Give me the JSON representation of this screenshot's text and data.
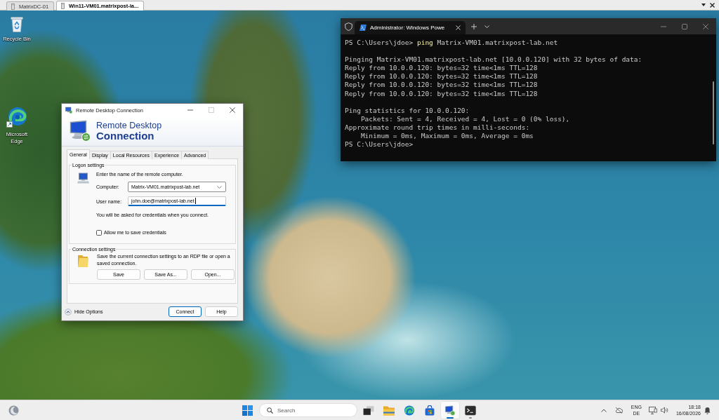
{
  "session_tabs": [
    {
      "label": "MatrixDC-01",
      "selected": false
    },
    {
      "label": "Win11-VM01.matrixpost-la...",
      "selected": true
    }
  ],
  "desktop_icons": [
    {
      "kind": "recycle-bin",
      "label": "Recycle Bin"
    },
    {
      "kind": "browser",
      "label": "Microsoft Edge"
    }
  ],
  "rdp_dialog": {
    "title": "Remote Desktop Connection",
    "maximize_disabled": true,
    "banner": {
      "line_1": "Remote Desktop",
      "line_2": "Connection"
    },
    "tabs": [
      {
        "label": "General",
        "selected": true
      },
      {
        "label": "Display",
        "selected": false
      },
      {
        "label": "Local Resources",
        "selected": false
      },
      {
        "label": "Experience",
        "selected": false
      },
      {
        "label": "Advanced",
        "selected": false
      }
    ],
    "logon_settings": {
      "legend": "Logon settings",
      "prompt": "Enter the name of the remote computer.",
      "computer": {
        "label": "Computer:",
        "value": "Matrix-VM01.matrixpost-lab.net"
      },
      "user_name": {
        "label": "User name:",
        "value": "john.doe@matrixpost-lab.net",
        "focused": true
      },
      "note": "You will be asked for credentials when you connect.",
      "save_credentials": {
        "label": "Allow me to save credentials",
        "checked": false
      }
    },
    "connection_settings": {
      "legend": "Connection settings",
      "description": "Save the current connection settings to an RDP file or open a saved connection.",
      "buttons": [
        "Save",
        "Save As...",
        "Open..."
      ]
    },
    "options_toggle": {
      "label": "Hide Options",
      "expanded": true
    },
    "buttons": [
      {
        "label": "Connect",
        "default": true
      },
      {
        "label": "Help",
        "default": false
      }
    ]
  },
  "terminal": {
    "tab_title": "Administrator: Windows Powe",
    "lines": [
      {
        "kind": "command",
        "prompt": "PS C:\\Users\\jdoe>",
        "command": "ping",
        "args": "Matrix-VM01.matrixpost-lab.net"
      },
      {
        "kind": "blank"
      },
      {
        "kind": "output",
        "text": "Pinging Matrix-VM01.matrixpost-lab.net [10.0.0.120] with 32 bytes of data:"
      },
      {
        "kind": "output",
        "text": "Reply from 10.0.0.120: bytes=32 time<1ms TTL=128"
      },
      {
        "kind": "output",
        "text": "Reply from 10.0.0.120: bytes=32 time<1ms TTL=128"
      },
      {
        "kind": "output",
        "text": "Reply from 10.0.0.120: bytes=32 time<1ms TTL=128"
      },
      {
        "kind": "output",
        "text": "Reply from 10.0.0.120: bytes=32 time<1ms TTL=128"
      },
      {
        "kind": "blank"
      },
      {
        "kind": "output",
        "text": "Ping statistics for 10.0.0.120:"
      },
      {
        "kind": "output",
        "text": "    Packets: Sent = 4, Received = 4, Lost = 0 (0% loss),"
      },
      {
        "kind": "output",
        "text": "Approximate round trip times in milli-seconds:"
      },
      {
        "kind": "output",
        "text": "    Minimum = 0ms, Maximum = 0ms, Average = 0ms"
      },
      {
        "kind": "prompt",
        "prompt": "PS C:\\Users\\jdoe>"
      }
    ]
  },
  "taskbar": {
    "search": {
      "placeholder": "Search"
    },
    "apps": [
      {
        "kind": "task-view",
        "running": false,
        "active": false
      },
      {
        "kind": "file-explorer",
        "running": false,
        "active": false
      },
      {
        "kind": "browser",
        "running": false,
        "active": false
      },
      {
        "kind": "store",
        "running": false,
        "active": false
      },
      {
        "kind": "remote-desktop",
        "running": true,
        "active": true
      },
      {
        "kind": "terminal",
        "running": true,
        "active": false
      }
    ],
    "tray": {
      "language": {
        "input": "ENG",
        "layout": "DE"
      },
      "time": "18:18",
      "date": "16/08/2026"
    }
  }
}
